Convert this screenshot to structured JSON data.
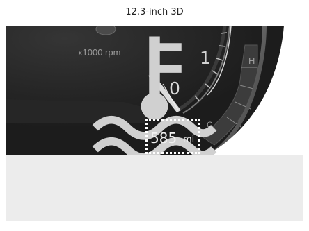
{
  "caption": "12.3-inch 3D",
  "tachometer": {
    "unit_label": "x1000 rpm",
    "scale_high": "1",
    "scale_low": "0"
  },
  "temperature_gauge": {
    "high_label": "H",
    "low_label": "C",
    "icon": "coolant-temperature-icon"
  },
  "range_display": {
    "value": "585",
    "unit": "mi"
  },
  "colors": {
    "cluster_background": "#1e1e1e",
    "highlight_box": "#ffffff",
    "lower_panel": "#ececec"
  }
}
